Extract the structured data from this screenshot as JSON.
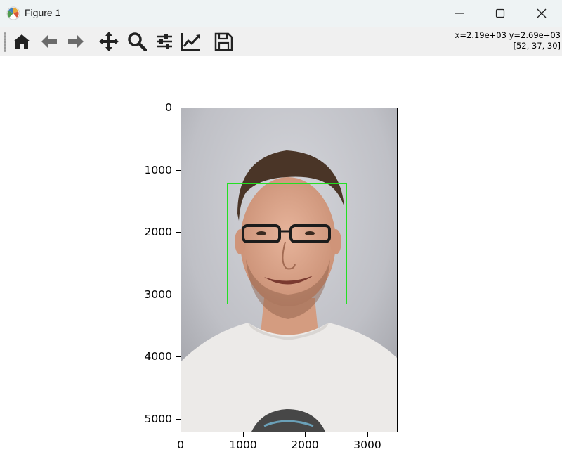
{
  "window": {
    "title": "Figure 1",
    "minimize_icon": "minimize-icon",
    "maximize_icon": "maximize-icon",
    "close_icon": "close-icon"
  },
  "toolbar": {
    "tools": [
      {
        "name": "home-icon"
      },
      {
        "name": "back-arrow-icon"
      },
      {
        "name": "forward-arrow-icon"
      },
      {
        "name": "pan-move-icon"
      },
      {
        "name": "zoom-magnifier-icon"
      },
      {
        "name": "configure-subplots-icon"
      },
      {
        "name": "edit-axis-curve-icon"
      },
      {
        "name": "save-floppy-icon"
      }
    ],
    "coord_readout": "x=2.19e+03 y=2.69e+03",
    "pixel_value": "[52, 37, 30]"
  },
  "axes": {
    "yticks": [
      "0",
      "1000",
      "2000",
      "3000",
      "4000",
      "5000"
    ],
    "xticks": [
      "0",
      "1000",
      "2000",
      "3000"
    ],
    "image_extent": {
      "width": 3456,
      "height": 5184
    },
    "face_box": {
      "x0": 750,
      "y0": 1220,
      "x1": 2650,
      "y1": 3150
    },
    "box_color": "#22e022"
  }
}
